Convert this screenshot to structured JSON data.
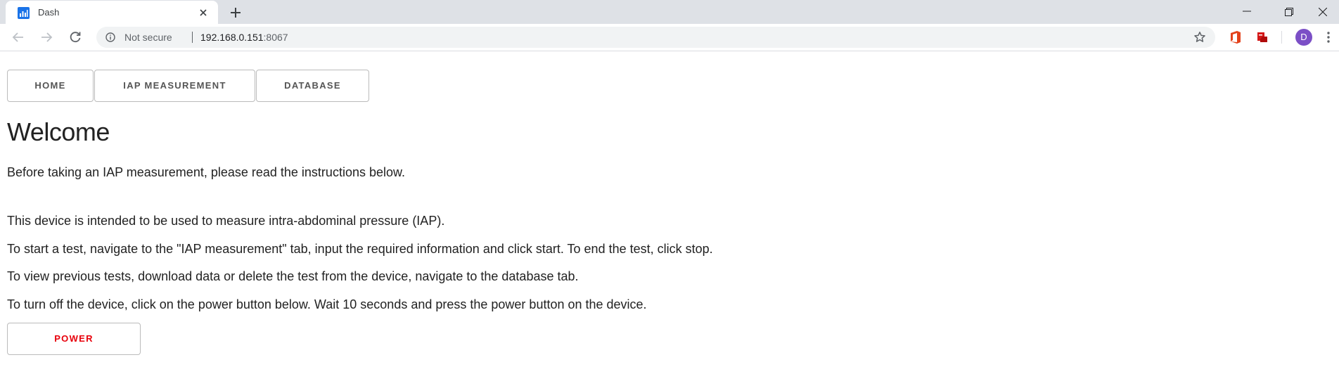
{
  "browser": {
    "tab_title": "Dash",
    "favicon": "dash-chart-icon",
    "not_secure_label": "Not secure",
    "url_host": "192.168.0.151",
    "url_port": ":8067",
    "avatar_letter": "D",
    "avatar_color": "#7b4fc6"
  },
  "nav_tabs": {
    "home": "HOME",
    "iap": "IAP MEASUREMENT",
    "database": "DATABASE"
  },
  "page": {
    "title": "Welcome",
    "intro": "Before taking an IAP measurement, please read the instructions below.",
    "paragraphs": [
      "This device is intended to be used to measure intra-abdominal pressure (IAP).",
      "To start a test, navigate to the \"IAP measurement\" tab, input the required information and click start. To end the test, click stop.",
      "To view previous tests, download data or delete the test from the device, navigate to the database tab.",
      "To turn off the device, click on the power button below. Wait 10 seconds and press the power button on the device."
    ],
    "power_button": "POWER",
    "power_color": "#e8000b"
  }
}
